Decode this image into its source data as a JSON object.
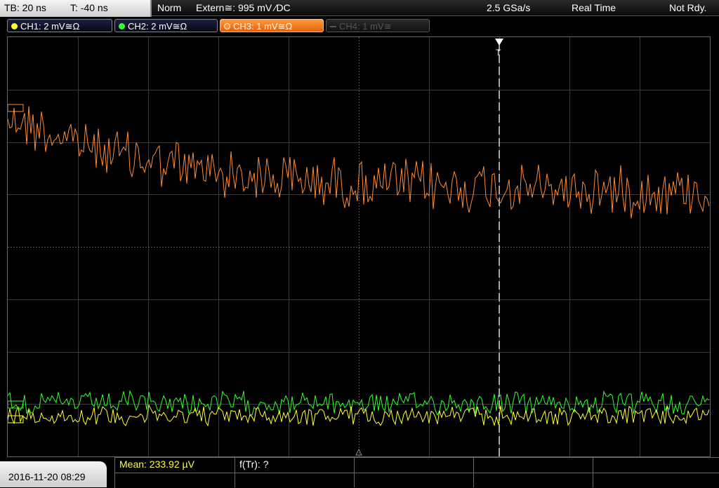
{
  "topbar": {
    "timebase": "TB: 20 ns",
    "trigger_time": "T: -40 ns",
    "trigger_mode": "Norm",
    "trigger_source": "Extern≅: 995 mV ⁄DC",
    "sample_rate": "2.5 GSa/s",
    "acq_mode": "Real Time",
    "status": "Not Rdy."
  },
  "channels": [
    {
      "label": "CH1: 2 mV≅Ω",
      "color": "#ffff30",
      "active": true
    },
    {
      "label": "CH2: 2 mV≅Ω",
      "color": "#30ff30",
      "active": true
    },
    {
      "label": "CH3: 1 mV≅Ω",
      "color": "#ff8c30",
      "active": true,
      "selected": true
    },
    {
      "label": "CH4: 1 mV≅",
      "color": "#555555",
      "active": false
    }
  ],
  "markers": {
    "trigger": "T"
  },
  "bottom": {
    "datetime": "2016-11-20 08:29",
    "mean": "Mean: 233.92 µV",
    "ftr": "f(Tr): ?"
  },
  "colors": {
    "ch1": "#ffff30",
    "ch2": "#30ff30",
    "ch3": "#ff8c30",
    "grid": "#3a3a3a"
  }
}
